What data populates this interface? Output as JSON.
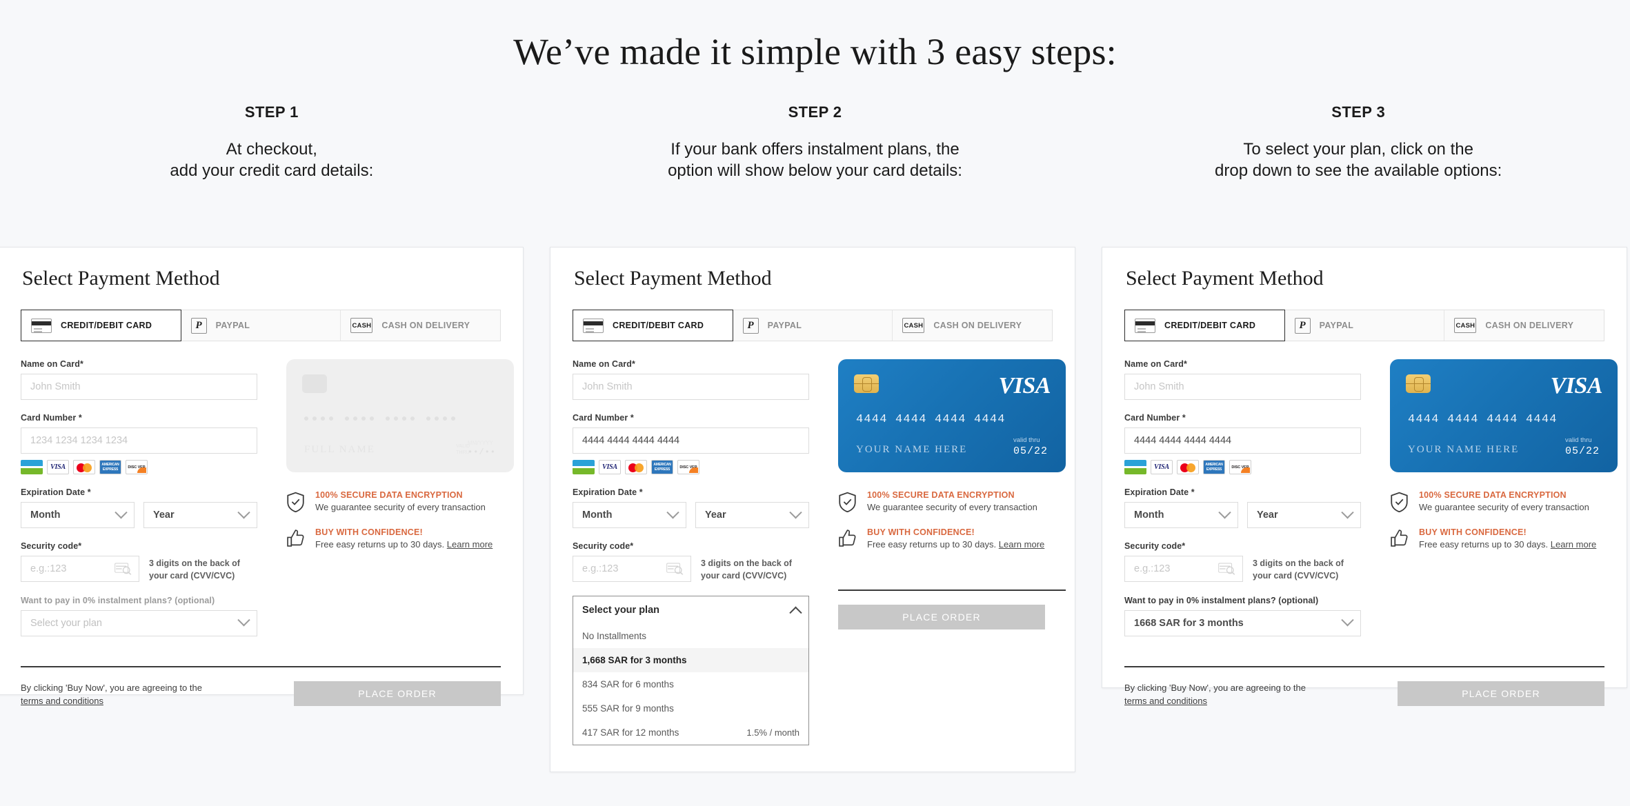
{
  "page": {
    "title": "We’ve made it simple with 3 easy steps:"
  },
  "steps": [
    {
      "label": "STEP 1",
      "line1": "At checkout,",
      "line2": "add your credit card details:"
    },
    {
      "label": "STEP 2",
      "line1": "If your bank offers instalment plans, the",
      "line2": "option will show below your card details:"
    },
    {
      "label": "STEP 3",
      "line1": "To select your plan, click on the",
      "line2": "drop down to see the available options:"
    }
  ],
  "panel": {
    "title": "Select Payment Method",
    "tabs": [
      {
        "label": "CREDIT/DEBIT CARD",
        "icon": "credit-card-icon",
        "active": true
      },
      {
        "label": "PAYPAL",
        "icon": "paypal-icon",
        "active": false
      },
      {
        "label": "CASH ON DELIVERY",
        "icon": "cash-icon",
        "active": false
      }
    ],
    "cash_icon_text": "CASH",
    "paypal_icon_text": "P",
    "fields": {
      "name_label": "Name on Card*",
      "name_placeholder": "John Smith",
      "card_label": "Card Number *",
      "card_placeholder": "1234 1234 1234 1234",
      "card_value": "4444 4444 4444 4444",
      "expiry_label": "Expiration Date *",
      "month_value": "Month",
      "year_value": "Year",
      "cvv_label": "Security code*",
      "cvv_placeholder": "e.g.:123",
      "cvv_hint": "3 digits on the back of your card (CVV/CVC)",
      "instalment_label": "Want to pay in 0% instalment plans? (optional)",
      "instalment_placeholder": "Select your plan",
      "instalment_selected": "1668 SAR for 3 months"
    },
    "brands": [
      {
        "name": "mada",
        "text": ""
      },
      {
        "name": "visa",
        "text": "VISA"
      },
      {
        "name": "mastercard",
        "text": ""
      },
      {
        "name": "amex",
        "text": "AMERICAN EXPRESS"
      },
      {
        "name": "discover",
        "text": "DISC VER"
      }
    ],
    "dropdown": {
      "header": "Select your plan",
      "options": [
        {
          "label": "No Installments",
          "rate": "",
          "selected": false
        },
        {
          "label": "1,668 SAR for 3 months",
          "rate": "",
          "selected": true
        },
        {
          "label": "834 SAR for 6 months",
          "rate": "",
          "selected": false
        },
        {
          "label": "555 SAR for 9 months",
          "rate": "",
          "selected": false
        },
        {
          "label": "417 SAR for 12 months",
          "rate": "1.5% / month",
          "selected": false
        }
      ]
    },
    "card_visual": {
      "blank_name": "FULL NAME",
      "blank_valid_label": "MM/YYYY",
      "blank_valid_value": "••/••",
      "blank_mini1": "VALID",
      "blank_mini2": "THRU",
      "visa_logo": "VISA",
      "visa_number": "4444 4444 4444 4444",
      "visa_name": "YOUR NAME HERE",
      "visa_valid_label": "valid thru",
      "visa_valid_value": "05/22"
    },
    "trust": [
      {
        "title": "100% SECURE DATA ENCRYPTION",
        "sub": "We guarantee security of every transaction",
        "link": "",
        "icon": "shield-check-icon"
      },
      {
        "title": "BUY WITH CONFIDENCE!",
        "sub": "Free easy returns up to 30 days.",
        "link": "Learn more",
        "icon": "thumbs-up-icon"
      }
    ],
    "footer": {
      "terms_line": "By clicking 'Buy Now', you are agreeing to the",
      "terms_link": "terms and conditions",
      "place_order": "PLACE ORDER"
    }
  },
  "colors": {
    "accent": "#d9683f",
    "visa_card": "#1872b4",
    "page_bg": "#f7f8fa",
    "button": "#c8c8c8"
  }
}
